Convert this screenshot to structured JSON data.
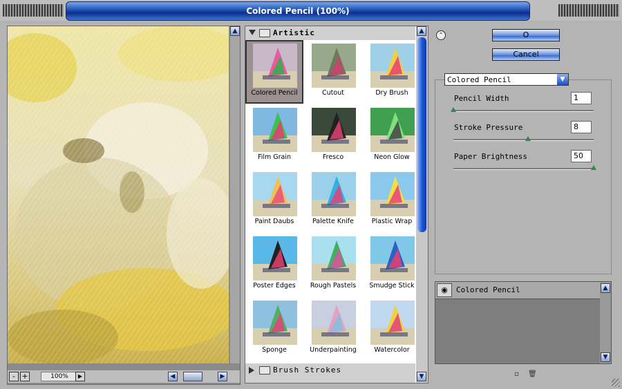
{
  "window": {
    "title": "Colored Pencil (100%)"
  },
  "preview": {
    "zoom": "100%",
    "zoom_out": "-",
    "zoom_in": "+"
  },
  "gallery": {
    "category": "Artistic",
    "selected": "Colored Pencil",
    "filters": [
      "Colored Pencil",
      "Cutout",
      "Dry Brush",
      "Film Grain",
      "Fresco",
      "Neon Glow",
      "Paint Daubs",
      "Palette Knife",
      "Plastic Wrap",
      "Poster Edges",
      "Rough Pastels",
      "Smudge Stick",
      "Sponge",
      "Underpainting",
      "Watercolor"
    ],
    "next_category": "Brush Strokes"
  },
  "actions": {
    "ok": "O",
    "cancel": "Cancel"
  },
  "settings": {
    "filter": "Colored Pencil",
    "params": [
      {
        "label": "Pencil Width",
        "value": "1",
        "min": 1,
        "max": 24
      },
      {
        "label": "Stroke Pressure",
        "value": "8",
        "min": 0,
        "max": 15
      },
      {
        "label": "Paper Brightness",
        "value": "50",
        "min": 0,
        "max": 50
      }
    ]
  },
  "layers": [
    {
      "name": "Colored Pencil",
      "visible": true
    }
  ],
  "colors": {
    "accent": "#1f4fc0",
    "panel": "#b4b4b4",
    "slider_knob": "#2e8a4a"
  }
}
